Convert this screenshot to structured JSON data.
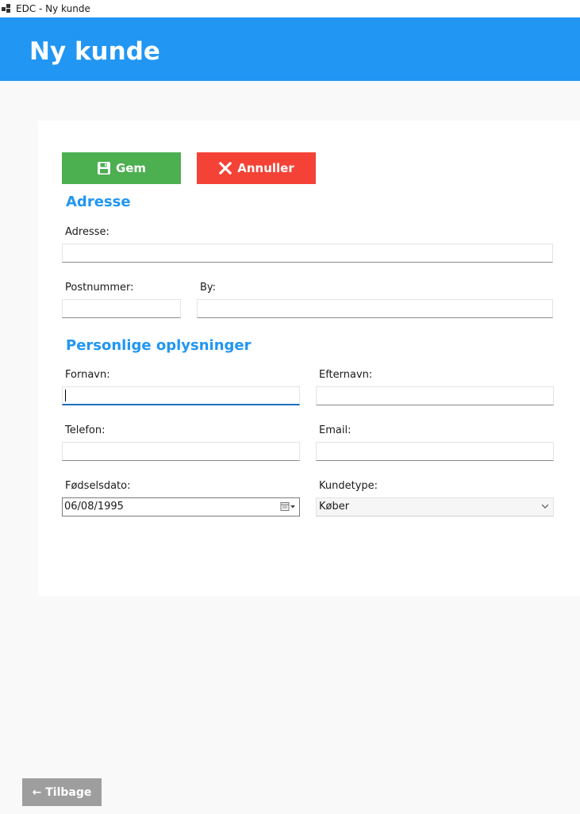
{
  "window": {
    "title": "EDC - Ny kunde"
  },
  "header": {
    "title": "Ny kunde"
  },
  "toolbar": {
    "save_label": "Gem",
    "cancel_label": "Annuller"
  },
  "address_section": {
    "title": "Adresse",
    "address_label": "Adresse:",
    "address_value": "",
    "postal_label": "Postnummer:",
    "postal_value": "",
    "city_label": "By:",
    "city_value": ""
  },
  "personal_section": {
    "title": "Personlige oplysninger",
    "firstname_label": "Fornavn:",
    "firstname_value": "",
    "lastname_label": "Efternavn:",
    "lastname_value": "",
    "phone_label": "Telefon:",
    "phone_value": "",
    "email_label": "Email:",
    "email_value": "",
    "birthdate_label": "Fødselsdato:",
    "birthdate_value": "06/08/1995",
    "customertype_label": "Kundetype:",
    "customertype_value": "Køber"
  },
  "footer": {
    "back_label": "← Tilbage"
  },
  "colors": {
    "header": "#2196f3",
    "save": "#4caf50",
    "cancel": "#f44336",
    "back": "#9e9e9e",
    "section_title": "#2196f3"
  },
  "icons": {
    "save": "floppy-disk-icon",
    "cancel": "close-icon",
    "calendar": "calendar-icon",
    "dropdown": "chevron-down-icon"
  }
}
